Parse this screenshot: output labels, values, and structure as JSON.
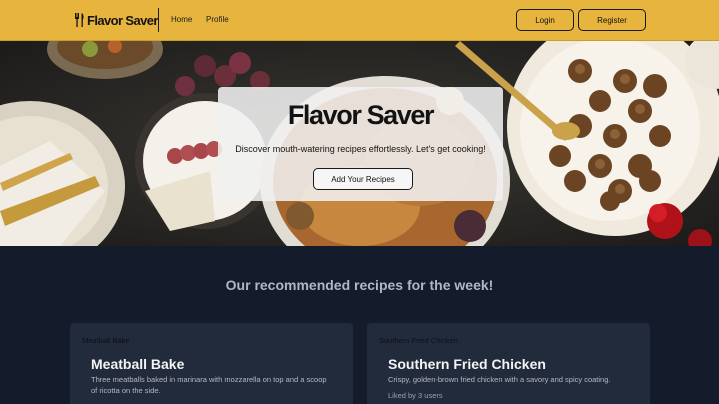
{
  "navbar": {
    "brand_name": "Flavor Saver",
    "links": {
      "home": "Home",
      "profile": "Profile"
    },
    "login_label": "Login",
    "register_label": "Register"
  },
  "hero": {
    "title": "Flavor Saver",
    "subtitle": "Discover mouth-watering recipes effortlessly. Let's get cooking!",
    "cta_label": "Add Your Recipes"
  },
  "recommended": {
    "heading": "Our recommended recipes for the week!",
    "cards": [
      {
        "tag": "Meatball Bake",
        "title": "Meatball Bake",
        "description": "Three meatballs baked in marinara with mozzarella on top and a scoop of ricotta on the side.",
        "likes": ""
      },
      {
        "tag": "Southern Fried Chicken",
        "title": "Southern Fried Chicken",
        "description": "Crispy, golden-brown fried chicken with a savory and spicy coating.",
        "likes": "Liked by 3 users"
      }
    ]
  },
  "colors": {
    "navbar_bg": "#e7b53d",
    "page_bg": "#141c2b",
    "card_bg": "#222b3b",
    "hero_card_bg": "#f0f0f0"
  },
  "icons": {
    "brand": "utensils-icon"
  }
}
